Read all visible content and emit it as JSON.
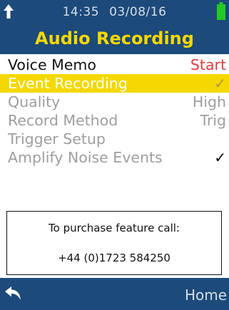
{
  "status_bar": {
    "time": "14:35",
    "date": "03/08/16",
    "signal_icon": "arrow-up-icon",
    "battery_icon": "battery-full-icon",
    "battery_color": "#22cc22"
  },
  "header": {
    "title": "Audio Recording",
    "background": "#1c4a7a",
    "title_color": "#f5d800"
  },
  "menu": {
    "items": [
      {
        "label": "Voice Memo",
        "value": "Start"
      },
      {
        "label": "Event Recording",
        "value": "",
        "checked": true,
        "selected": true
      },
      {
        "label": "Quality",
        "value": "High"
      },
      {
        "label": "Record Method",
        "value": "Trig"
      },
      {
        "label": "Trigger Setup",
        "value": ""
      },
      {
        "label": "Amplify Noise Events",
        "value": "",
        "checked": true
      }
    ],
    "check_glyph": "✓"
  },
  "purchase": {
    "line1": "To purchase feature call:",
    "line2": "+44 (0)1723 584250"
  },
  "footer": {
    "back_icon": "back-arrow-icon",
    "home_label": "Home"
  }
}
